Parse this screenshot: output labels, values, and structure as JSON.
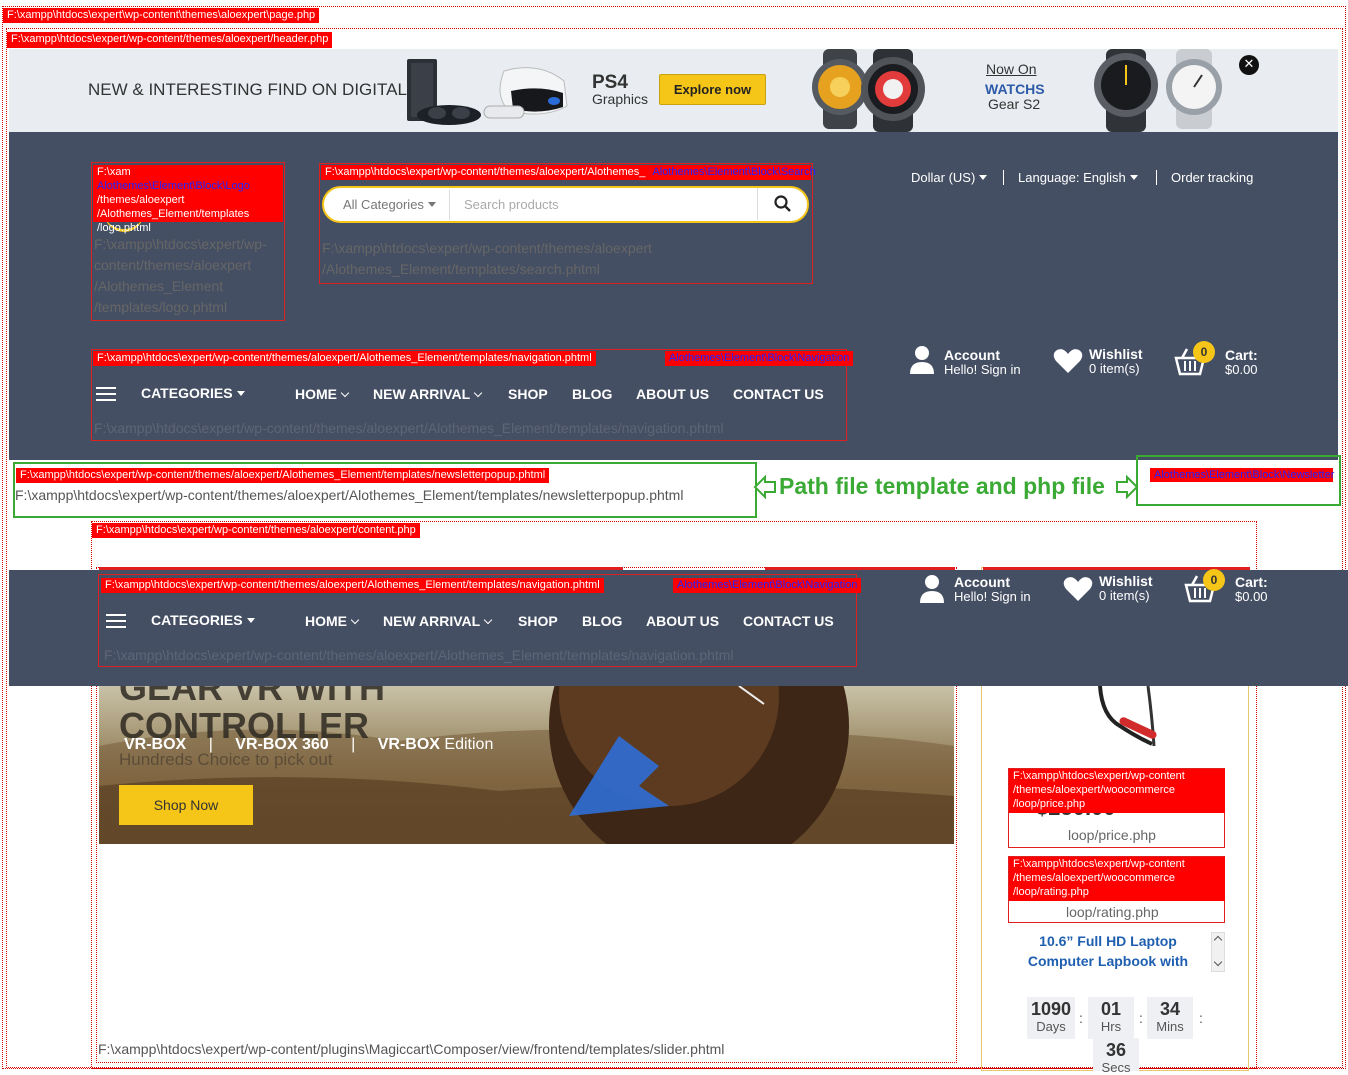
{
  "labels": {
    "page_php": "F:\\xampp\\htdocs\\expert\\wp-content\\themes\\aloexpert\\page.php",
    "header_php": "F:\\xampp\\htdocs\\expert/wp-content/themes/aloexpert/header.php",
    "logo_red_prefix": "F:\\xam",
    "logo_red_block": "Alothemes\\Element\\Block\\Logo",
    "logo_red_rest": "/themes/aloexpert /Alothemes_Element/templates /logo.phtml",
    "logo_grey": "F:\\xampp\\htdocs\\expert/wp-content/themes/aloexpert /Alothemes_Element /templates/logo.phtml",
    "search_red": "F:\\xampp\\htdocs\\expert/wp-content/themes/aloexpert/Alothemes_",
    "search_red_block": "Alothemes\\Element\\Block\\Search",
    "search_grey": "F:\\xampp\\htdocs\\expert/wp-content/themes/aloexpert /Alothemes_Element/templates/search.phtml",
    "nav_red": "F:\\xampp\\htdocs\\expert/wp-content/themes/aloexpert/Alothemes_Element/templates/navigation.phtml",
    "nav_red_block": "Alothemes\\Element\\Block\\Navigation",
    "nav_grey": "F:\\xampp\\htdocs\\expert/wp-content/themes/aloexpert/Alothemes_Element/templates/navigation.phtml",
    "newsletter_red": "F:\\xampp\\htdocs\\expert/wp-content/themes/aloexpert/Alothemes_Element/templates/newsletterpopup.phtml",
    "newsletter_grey": "F:\\xampp\\htdocs\\expert/wp-content/themes/aloexpert/Alothemes_Element/templates/newsletterpopup.phtml",
    "newsletter_block": "Alothemes\\Element\\Block\\Newsletter",
    "annotation": "Path file template and php file",
    "content_php": "F:\\xampp\\htdocs\\expert/wp-content/themes/aloexpert/content.php",
    "price_red": "F:\\xampp\\htdocs\\expert/wp-content /themes/aloexpert/woocommerce /loop/price.php",
    "price_grey": "loop/price.php",
    "rating_red": "F:\\xampp\\htdocs\\expert/wp-content /themes/aloexpert/woocommerce /loop/rating.php",
    "rating_grey": "loop/rating.php",
    "slider_grey": "F:\\xampp\\htdocs\\expert/wp-content/plugins\\Magiccart\\Composer/view/frontend/templates/slider.phtml"
  },
  "topbar": {
    "headline": "NEW & INTERESTING FIND ON DIGITAL",
    "ps4_title": "PS4",
    "ps4_sub": "Graphics",
    "explore_label": "Explore now",
    "now_on": "Now On",
    "watchs": "WATCHS",
    "gear": "Gear S2"
  },
  "header": {
    "currency": "Dollar (US)",
    "language": "Language: English",
    "order_tracking": "Order tracking",
    "search_category": "All Categories",
    "search_placeholder": "Search products"
  },
  "nav": {
    "categories": "CATEGORIES",
    "items": [
      "HOME",
      "NEW ARRIVAL",
      "SHOP",
      "BLOG",
      "ABOUT US",
      "CONTACT US"
    ]
  },
  "account": {
    "account_title": "Account",
    "account_sub": "Hello! Sign in",
    "wishlist_title": "Wishlist",
    "wishlist_sub": "0 item(s)",
    "cart_title": "Cart:",
    "cart_total": "$0.00",
    "cart_count": "0"
  },
  "slider": {
    "headline_1": "GEAR VR WITH",
    "headline_2": "CONTROLLER",
    "vr1": "VR-BOX",
    "sep": "|",
    "vr2": "VR-BOX 360",
    "vr3a": "VR-BOX",
    "vr3b": " Edition",
    "subtext": "Hundreds Choice to pick out",
    "shop_now": "Shop Now"
  },
  "product": {
    "price_partial": "$250.00",
    "title_line1": "10.6” Full HD Laptop",
    "title_line2": "Computer Lapbook with"
  },
  "countdown": {
    "days": "1090",
    "days_label": "Days",
    "hrs": "01",
    "hrs_label": "Hrs",
    "mins": "34",
    "mins_label": "Mins",
    "secs": "36",
    "secs_label": "Secs",
    "colon": ":"
  },
  "colors": {
    "header_bg": "#454f63",
    "topbar_bg": "#e9edf2",
    "accent_yellow": "#f5c518",
    "debug_red": "#ff0000",
    "annotation_green": "#3aaa35",
    "product_title": "#1f5fb0"
  }
}
